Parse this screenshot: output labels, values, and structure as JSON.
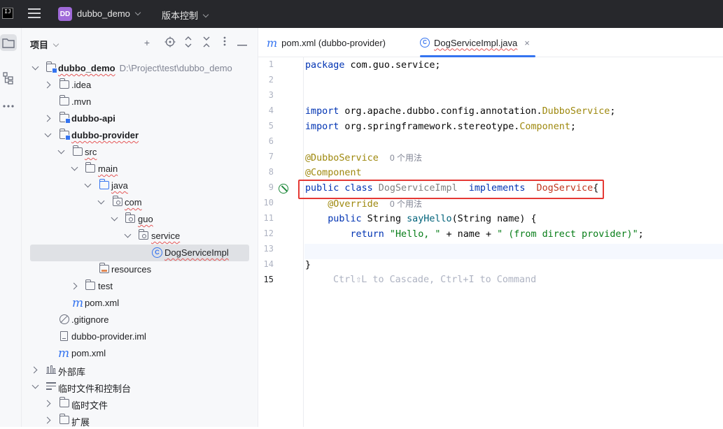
{
  "titlebar": {
    "logo": "IJ",
    "project_badge": "DD",
    "project_name": "dubbo_demo",
    "vcs_label": "版本控制",
    "bg_color": "#27282c"
  },
  "left_toolbar": {
    "items": [
      "project-icon",
      "structure-icon",
      "more-icon"
    ]
  },
  "project_panel": {
    "title": "项目",
    "tree": [
      {
        "label": "dubbo_demo",
        "path": "D:\\Project\\test\\dubbo_demo"
      },
      {
        "label": ".idea"
      },
      {
        "label": ".mvn"
      },
      {
        "label": "dubbo-api"
      },
      {
        "label": "dubbo-provider"
      },
      {
        "label": "src"
      },
      {
        "label": "main"
      },
      {
        "label": "java"
      },
      {
        "label": "com"
      },
      {
        "label": "guo"
      },
      {
        "label": "service"
      },
      {
        "label": "DogServiceImpl"
      },
      {
        "label": "resources"
      },
      {
        "label": "test"
      },
      {
        "label": "pom.xml"
      },
      {
        "label": ".gitignore"
      },
      {
        "label": "dubbo-provider.iml"
      },
      {
        "label": "pom.xml"
      },
      {
        "label": "外部库"
      },
      {
        "label": "临时文件和控制台"
      },
      {
        "label": "临时文件"
      },
      {
        "label": "扩展"
      }
    ]
  },
  "editor": {
    "tabs": [
      {
        "label": "pom.xml (dubbo-provider)",
        "icon": "maven-icon",
        "active": false
      },
      {
        "label": "DogServiceImpl.java",
        "icon": "class-icon",
        "active": true
      }
    ],
    "line_numbers": [
      "1",
      "2",
      "3",
      "4",
      "5",
      "6",
      "7",
      "8",
      "9",
      "10",
      "11",
      "12",
      "13",
      "14",
      "15"
    ],
    "current_line": "15",
    "code": {
      "l1_kw": "package",
      "l1_rest": " com.guo.service;",
      "l4_kw": "import",
      "l4_pkg": " org.apache.dubbo.config.annotation.",
      "l4_cls": "DubboService",
      "l4_end": ";",
      "l5_kw": "import",
      "l5_pkg": " org.springframework.stereotype.",
      "l5_cls": "Component",
      "l5_end": ";",
      "l7_ann": "@DubboService",
      "l7_hint": "0 个用法",
      "l8_ann": "@Component",
      "l9_kw": "public class",
      "l9_cls": " DogServiceImpl ",
      "l9_kw2": " implements ",
      "l9_iface": " DogService",
      "l9_end": "{",
      "l10_ann": "@Override",
      "l10_hint": "0 个用法",
      "l11_kw": "public",
      "l11_type": " String ",
      "l11_mth": "sayHello",
      "l11_rest": "(String name) {",
      "l12_kw": "return",
      "l12_s1": " \"Hello, \"",
      "l12_mid": " + name + ",
      "l12_s2": "\" (from direct provider)\"",
      "l12_end": ";",
      "l13": "}",
      "l14": "}",
      "l15_ghost": "Ctrl⇧L to Cascade, Ctrl+I to Command"
    }
  },
  "highlight_color": "#e53935"
}
